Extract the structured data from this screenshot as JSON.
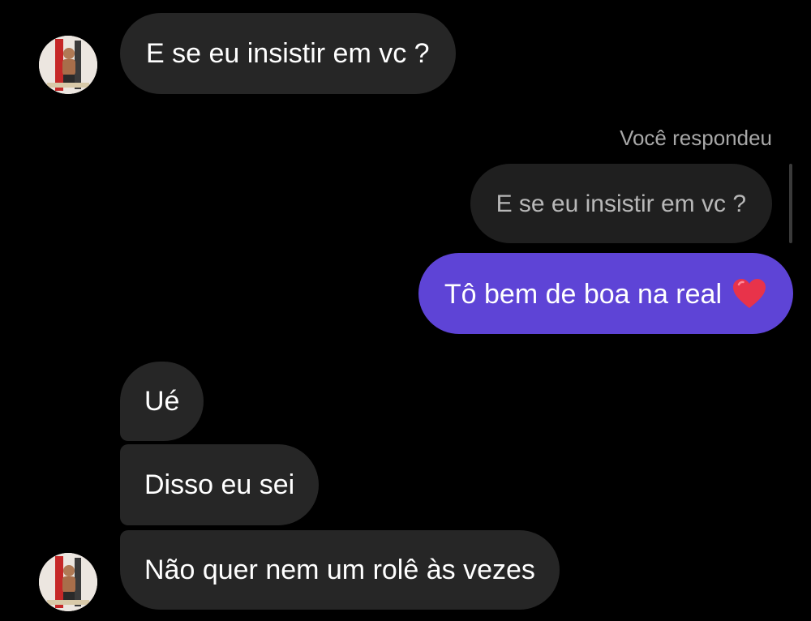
{
  "messages": [
    {
      "from": "other",
      "text": "E se eu insistir em vc ?"
    },
    {
      "from": "me",
      "reply_label": "Você respondeu",
      "quoted_text": "E se eu insistir em vc ?",
      "text": "Tô bem de boa na real",
      "emoji": "red-heart-icon"
    },
    {
      "from": "other",
      "text": "Ué"
    },
    {
      "from": "other",
      "text": "Disso eu sei"
    },
    {
      "from": "other",
      "text": "Não quer nem um rolê às vezes"
    }
  ],
  "colors": {
    "background": "#000000",
    "incoming_bubble": "#262626",
    "outgoing_bubble": "#5e44d6",
    "quoted_bubble": "#1f1f1f",
    "heart": "#e8334a"
  }
}
